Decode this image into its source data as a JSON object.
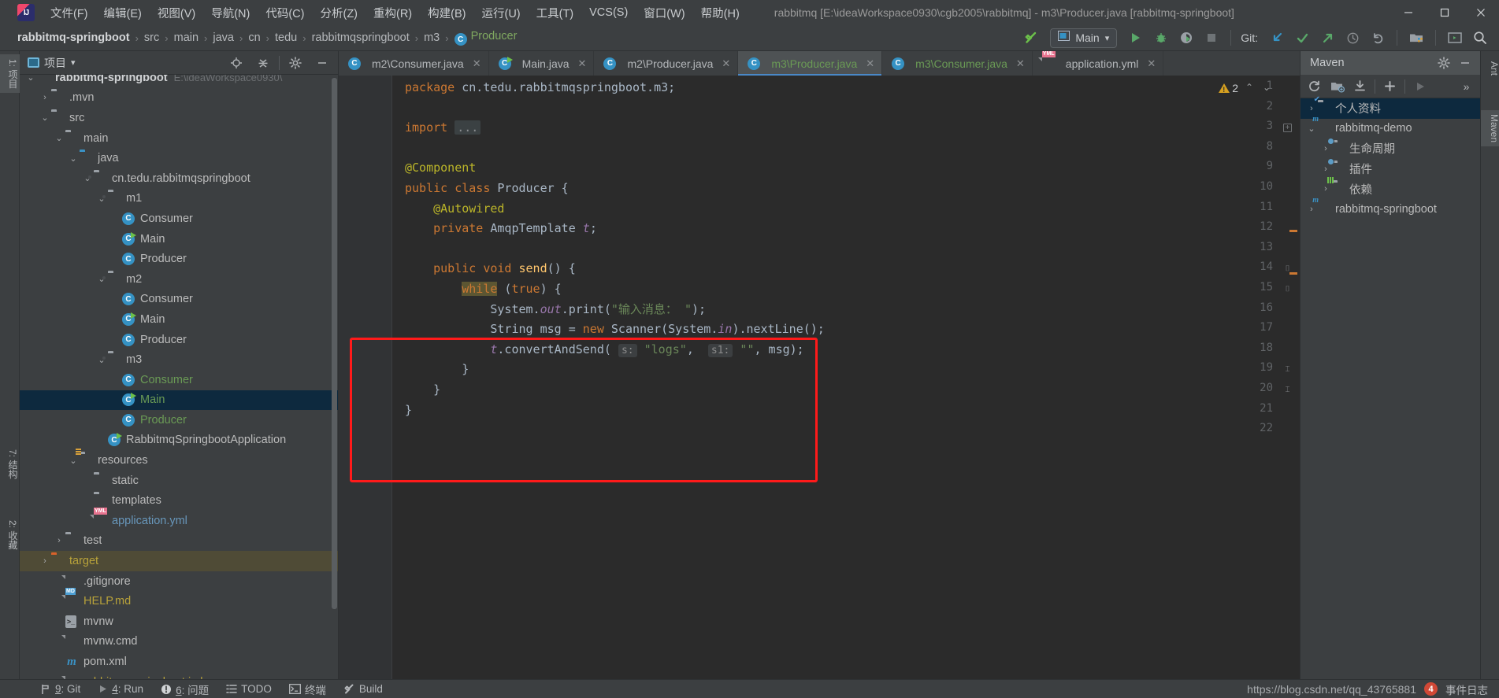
{
  "window": {
    "title": "rabbitmq [E:\\ideaWorkspace0930\\cgb2005\\rabbitmq] - m3\\Producer.java [rabbitmq-springboot]",
    "app_icon": "intellij-idea-icon",
    "minimize": "─",
    "maximize": "☐",
    "close": "✕"
  },
  "menu": {
    "items": [
      {
        "label": "文件(F)",
        "name": "menu-file"
      },
      {
        "label": "编辑(E)",
        "name": "menu-edit"
      },
      {
        "label": "视图(V)",
        "name": "menu-view"
      },
      {
        "label": "导航(N)",
        "name": "menu-navigate"
      },
      {
        "label": "代码(C)",
        "name": "menu-code"
      },
      {
        "label": "分析(Z)",
        "name": "menu-analyze"
      },
      {
        "label": "重构(R)",
        "name": "menu-refactor"
      },
      {
        "label": "构建(B)",
        "name": "menu-build"
      },
      {
        "label": "运行(U)",
        "name": "menu-run"
      },
      {
        "label": "工具(T)",
        "name": "menu-tools"
      },
      {
        "label": "VCS(S)",
        "name": "menu-vcs"
      },
      {
        "label": "窗口(W)",
        "name": "menu-window"
      },
      {
        "label": "帮助(H)",
        "name": "menu-help"
      }
    ]
  },
  "breadcrumb": {
    "separator": "›",
    "items": [
      {
        "label": "rabbitmq-springboot",
        "style": "bold"
      },
      {
        "label": "src",
        "style": "plain"
      },
      {
        "label": "main",
        "style": "plain"
      },
      {
        "label": "java",
        "style": "plain"
      },
      {
        "label": "cn",
        "style": "plain"
      },
      {
        "label": "tedu",
        "style": "plain"
      },
      {
        "label": "rabbitmqspringboot",
        "style": "plain"
      },
      {
        "label": "m3",
        "style": "plain"
      },
      {
        "label": "Producer",
        "style": "class-green"
      }
    ]
  },
  "toolbar": {
    "build_icon": "hammer-icon",
    "run_config": {
      "label": "Main",
      "icon": "run-config-icon",
      "chevron": "▾"
    },
    "run_icon": "run-play-icon",
    "debug_icon": "debug-bug-icon",
    "coverage_icon": "run-coverage-icon",
    "stop_icon": "stop-square-icon",
    "git_label": "Git:",
    "git_update_icon": "update-project-arrow-icon",
    "git_commit_icon": "commit-check-icon",
    "git_push_icon": "push-arrow-icon",
    "git_history_icon": "history-clock-icon",
    "git_rollback_icon": "rollback-undo-icon",
    "structure_icon": "project-structure-icon",
    "terminal_icon": "terminal-window-icon",
    "search_icon": "search-everywhere-icon"
  },
  "left_strip": {
    "tabs": [
      {
        "label": "1: 项目",
        "active": true,
        "name": "tool-tab-project"
      },
      {
        "label": "7: 结构",
        "active": false,
        "name": "tool-tab-structure"
      },
      {
        "label": "2: 收藏",
        "active": false,
        "name": "tool-tab-favorites"
      }
    ]
  },
  "right_strip": {
    "tabs": [
      {
        "label": "Ant",
        "active": false,
        "name": "tool-tab-ant"
      },
      {
        "label": "Maven",
        "active": true,
        "name": "tool-tab-maven"
      }
    ]
  },
  "project_panel": {
    "title": "项目",
    "chevron": "▾",
    "locate_icon": "locate-target-icon",
    "collapse_icon": "collapse-all-icon",
    "settings_icon": "gear-icon",
    "hide_icon": "hide-panel-icon",
    "tree": [
      {
        "label": "rabbitmq-springboot",
        "path": "E:\\ideaWorkspace0930\\",
        "indent": 0,
        "arrow": "⌄",
        "icon": "module-folder",
        "style": "bold",
        "state": "partial"
      },
      {
        "label": ".mvn",
        "indent": 1,
        "arrow": "›",
        "icon": "folder",
        "style": "plain"
      },
      {
        "label": "src",
        "indent": 1,
        "arrow": "⌄",
        "icon": "folder",
        "style": "plain"
      },
      {
        "label": "main",
        "indent": 2,
        "arrow": "⌄",
        "icon": "folder",
        "style": "plain"
      },
      {
        "label": "java",
        "indent": 3,
        "arrow": "⌄",
        "icon": "folder-blue",
        "style": "plain"
      },
      {
        "label": "cn.tedu.rabbitmqspringboot",
        "indent": 4,
        "arrow": "⌄",
        "icon": "package",
        "style": "plain"
      },
      {
        "label": "m1",
        "indent": 5,
        "arrow": "⌄",
        "icon": "package",
        "style": "plain"
      },
      {
        "label": "Consumer",
        "indent": 6,
        "arrow": "",
        "icon": "class",
        "style": "plain"
      },
      {
        "label": "Main",
        "indent": 6,
        "arrow": "",
        "icon": "class-runnable",
        "style": "plain"
      },
      {
        "label": "Producer",
        "indent": 6,
        "arrow": "",
        "icon": "class",
        "style": "plain"
      },
      {
        "label": "m2",
        "indent": 5,
        "arrow": "⌄",
        "icon": "package",
        "style": "plain"
      },
      {
        "label": "Consumer",
        "indent": 6,
        "arrow": "",
        "icon": "class",
        "style": "plain"
      },
      {
        "label": "Main",
        "indent": 6,
        "arrow": "",
        "icon": "class-runnable",
        "style": "plain"
      },
      {
        "label": "Producer",
        "indent": 6,
        "arrow": "",
        "icon": "class",
        "style": "plain"
      },
      {
        "label": "m3",
        "indent": 5,
        "arrow": "⌄",
        "icon": "package",
        "style": "plain"
      },
      {
        "label": "Consumer",
        "indent": 6,
        "arrow": "",
        "icon": "class",
        "style": "green"
      },
      {
        "label": "Main",
        "indent": 6,
        "arrow": "",
        "icon": "class-runnable",
        "style": "green",
        "selected": true
      },
      {
        "label": "Producer",
        "indent": 6,
        "arrow": "",
        "icon": "class",
        "style": "green"
      },
      {
        "label": "RabbitmqSpringbootApplication",
        "indent": 5,
        "arrow": "",
        "icon": "class-runnable",
        "style": "plain"
      },
      {
        "label": "resources",
        "indent": 3,
        "arrow": "⌄",
        "icon": "folder-resources",
        "style": "plain"
      },
      {
        "label": "static",
        "indent": 4,
        "arrow": "",
        "icon": "folder",
        "style": "plain"
      },
      {
        "label": "templates",
        "indent": 4,
        "arrow": "",
        "icon": "folder",
        "style": "plain"
      },
      {
        "label": "application.yml",
        "indent": 4,
        "arrow": "",
        "icon": "file-yml",
        "style": "blue"
      },
      {
        "label": "test",
        "indent": 2,
        "arrow": "›",
        "icon": "folder",
        "style": "plain"
      },
      {
        "label": "target",
        "indent": 1,
        "arrow": "›",
        "icon": "folder-orange",
        "style": "yellow",
        "highlight": true
      },
      {
        "label": ".gitignore",
        "indent": 2,
        "arrow": "",
        "icon": "file-ignore",
        "style": "plain"
      },
      {
        "label": "HELP.md",
        "indent": 2,
        "arrow": "",
        "icon": "file-md",
        "style": "yellow"
      },
      {
        "label": "mvnw",
        "indent": 2,
        "arrow": "",
        "icon": "file-script",
        "style": "plain"
      },
      {
        "label": "mvnw.cmd",
        "indent": 2,
        "arrow": "",
        "icon": "file-cmd",
        "style": "plain"
      },
      {
        "label": "pom.xml",
        "indent": 2,
        "arrow": "",
        "icon": "file-maven",
        "style": "plain"
      },
      {
        "label": "rabbitmq-springboot.iml",
        "indent": 2,
        "arrow": "",
        "icon": "file-iml",
        "style": "yellow",
        "partial": true
      }
    ]
  },
  "editor": {
    "tabs": [
      {
        "label": "m2\\Consumer.java",
        "icon": "class",
        "active": false,
        "close": "✕",
        "style": "plain"
      },
      {
        "label": "Main.java",
        "icon": "class-runnable",
        "active": false,
        "close": "✕",
        "style": "plain"
      },
      {
        "label": "m2\\Producer.java",
        "icon": "class",
        "active": false,
        "close": "✕",
        "style": "plain"
      },
      {
        "label": "m3\\Producer.java",
        "icon": "class",
        "active": true,
        "close": "✕",
        "style": "green"
      },
      {
        "label": "m3\\Consumer.java",
        "icon": "class",
        "active": false,
        "close": "✕",
        "style": "green"
      },
      {
        "label": "application.yml",
        "icon": "file-yml",
        "active": false,
        "close": "✕",
        "style": "plain"
      }
    ],
    "warning_count": "2",
    "warning_icon": "warning-triangle-icon",
    "prev_icon": "⌃",
    "next_icon": "⌄",
    "line_numbers": [
      "1",
      "2",
      "3",
      "8",
      "9",
      "10",
      "11",
      "12",
      "13",
      "14",
      "15",
      "16",
      "17",
      "18",
      "19",
      "20",
      "21",
      "22"
    ],
    "code_lines": [
      {
        "n": "1",
        "tokens": [
          {
            "t": "package",
            "c": "kw"
          },
          {
            "t": " cn.tedu.rabbitmqspringboot.m3;",
            "c": "pl"
          }
        ]
      },
      {
        "n": "2",
        "tokens": []
      },
      {
        "n": "3",
        "tokens": [
          {
            "t": "import",
            "c": "kw"
          },
          {
            "t": " ",
            "c": "pl"
          },
          {
            "t": "...",
            "c": "fold"
          }
        ],
        "fold": "collapsed"
      },
      {
        "n": "8",
        "tokens": []
      },
      {
        "n": "9",
        "tokens": [
          {
            "t": "@Component",
            "c": "an"
          }
        ]
      },
      {
        "n": "10",
        "tokens": [
          {
            "t": "public",
            "c": "kw"
          },
          {
            "t": " ",
            "c": "pl"
          },
          {
            "t": "class",
            "c": "kw"
          },
          {
            "t": " Producer {",
            "c": "pl"
          }
        ]
      },
      {
        "n": "11",
        "tokens": [
          {
            "t": "    @Autowired",
            "c": "an"
          }
        ]
      },
      {
        "n": "12",
        "tokens": [
          {
            "t": "    ",
            "c": "pl"
          },
          {
            "t": "private",
            "c": "kw"
          },
          {
            "t": " AmqpTemplate ",
            "c": "pl"
          },
          {
            "t": "t",
            "c": "fi"
          },
          {
            "t": ";",
            "c": "pl"
          }
        ]
      },
      {
        "n": "13",
        "tokens": []
      },
      {
        "n": "14",
        "tokens": [
          {
            "t": "    ",
            "c": "pl"
          },
          {
            "t": "public",
            "c": "kw"
          },
          {
            "t": " ",
            "c": "pl"
          },
          {
            "t": "void",
            "c": "kw"
          },
          {
            "t": " ",
            "c": "pl"
          },
          {
            "t": "send",
            "c": "fn"
          },
          {
            "t": "() {",
            "c": "pl"
          }
        ],
        "fold": "open"
      },
      {
        "n": "15",
        "tokens": [
          {
            "t": "        ",
            "c": "pl"
          },
          {
            "t": "while",
            "c": "kw hl"
          },
          {
            "t": " (",
            "c": "pl"
          },
          {
            "t": "true",
            "c": "kw"
          },
          {
            "t": ") {",
            "c": "pl"
          }
        ],
        "fold": "open"
      },
      {
        "n": "16",
        "tokens": [
          {
            "t": "            System.",
            "c": "pl"
          },
          {
            "t": "out",
            "c": "fi"
          },
          {
            "t": ".print(",
            "c": "pl"
          },
          {
            "t": "\"输入消息： \"",
            "c": "st"
          },
          {
            "t": ");",
            "c": "pl"
          }
        ]
      },
      {
        "n": "17",
        "tokens": [
          {
            "t": "            String msg = ",
            "c": "pl"
          },
          {
            "t": "new",
            "c": "kw"
          },
          {
            "t": " Scanner(System.",
            "c": "pl"
          },
          {
            "t": "in",
            "c": "fi"
          },
          {
            "t": ").nextLine();",
            "c": "pl"
          }
        ]
      },
      {
        "n": "18",
        "tokens": [
          {
            "t": "            ",
            "c": "pl"
          },
          {
            "t": "t",
            "c": "fi"
          },
          {
            "t": ".convertAndSend( ",
            "c": "pl"
          },
          {
            "t": "s:",
            "c": "hint"
          },
          {
            "t": " ",
            "c": "pl"
          },
          {
            "t": "\"logs\"",
            "c": "st"
          },
          {
            "t": ",  ",
            "c": "pl"
          },
          {
            "t": "s1:",
            "c": "hint"
          },
          {
            "t": " ",
            "c": "pl"
          },
          {
            "t": "\"\"",
            "c": "st"
          },
          {
            "t": ", msg);",
            "c": "pl"
          }
        ]
      },
      {
        "n": "19",
        "tokens": [
          {
            "t": "        }",
            "c": "pl"
          }
        ],
        "fold": "close"
      },
      {
        "n": "20",
        "tokens": [
          {
            "t": "    }",
            "c": "pl"
          }
        ],
        "fold": "close"
      },
      {
        "n": "21",
        "tokens": [
          {
            "t": "}",
            "c": "pl"
          }
        ]
      },
      {
        "n": "22",
        "tokens": []
      }
    ],
    "annotation": {
      "name": "red-highlight-box",
      "color": "#ff1a1a"
    }
  },
  "maven_panel": {
    "title": "Maven",
    "settings_icon": "gear-icon",
    "hide_icon": "hide-panel-icon",
    "toolbar": {
      "reload_icon": "reload-icon",
      "add_module_icon": "add-maven-project-icon",
      "download_icon": "download-sources-icon",
      "add_icon": "+",
      "run_icon": "run-maven-build-icon",
      "more_icon": "»"
    },
    "tree": [
      {
        "label": "个人资料",
        "indent": 0,
        "arrow": "›",
        "icon": "profiles-icon",
        "selected": true
      },
      {
        "label": "rabbitmq-demo",
        "indent": 0,
        "arrow": "⌄",
        "icon": "maven-project-icon"
      },
      {
        "label": "生命周期",
        "indent": 1,
        "arrow": "›",
        "icon": "lifecycle-folder-icon"
      },
      {
        "label": "插件",
        "indent": 1,
        "arrow": "›",
        "icon": "plugins-folder-icon"
      },
      {
        "label": "依赖",
        "indent": 1,
        "arrow": "›",
        "icon": "dependencies-folder-icon"
      },
      {
        "label": "rabbitmq-springboot",
        "indent": 0,
        "arrow": "›",
        "icon": "maven-project-icon"
      }
    ]
  },
  "statusbar": {
    "items": [
      {
        "label": "9: Git",
        "num": "9",
        "rest": ": Git",
        "icon": "git-branch-icon",
        "name": "status-git"
      },
      {
        "label": "4: Run",
        "num": "4",
        "rest": ": Run",
        "icon": "run-play-icon",
        "name": "status-run"
      },
      {
        "label": "6: 问题",
        "num": "6",
        "rest": ": 问题",
        "icon": "problems-icon",
        "name": "status-problems"
      },
      {
        "label": "TODO",
        "num": "",
        "rest": "TODO",
        "icon": "todo-list-icon",
        "name": "status-todo"
      },
      {
        "label": "终端",
        "num": "",
        "rest": "终端",
        "icon": "terminal-icon",
        "name": "status-terminal"
      },
      {
        "label": "Build",
        "num": "",
        "rest": "Build",
        "icon": "hammer-icon",
        "name": "status-build"
      }
    ],
    "watermark": "https://blog.csdn.net/qq_43765881",
    "event_badge": "4",
    "event_label": "事件日志"
  },
  "colors": {
    "accent_blue": "#4a88c7",
    "class_icon": "#3592c4",
    "vcs_green": "#6a9a55",
    "highlight_red": "#ff1a1a",
    "selection": "#0d293e",
    "editor_bg": "#2b2b2b",
    "panel_bg": "#3c3f41"
  }
}
